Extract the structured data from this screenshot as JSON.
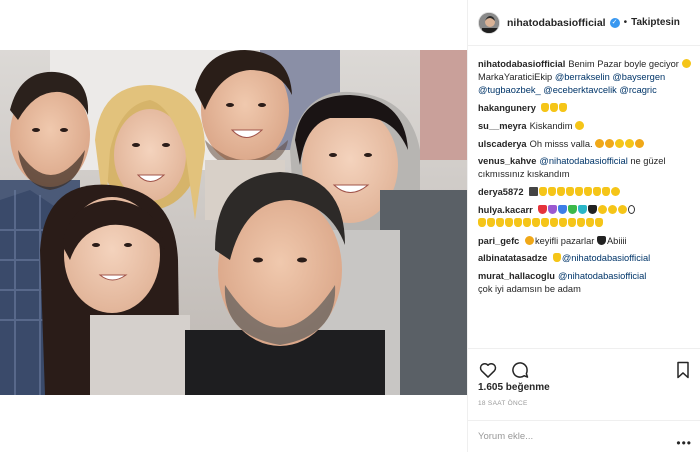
{
  "post": {
    "username": "nihatodabasiofficial",
    "follow_label": "Takiptesin",
    "separator": "•",
    "verified_icon": "verified-badge-icon",
    "photo_icon": "group-selfie-photo"
  },
  "caption": {
    "username": "nihatodabasiofficial",
    "text_1": "Benim Pazar boyle geciyor",
    "text_2": "MarkaYaraticiEkip",
    "mention_1": "@berrakselin",
    "mention_2": "@baysergen",
    "mention_3": "@tugbaozbek_",
    "mention_4": "@eceberktavcelik",
    "mention_5": "@rcagric"
  },
  "comments": [
    {
      "user": "hakangunery",
      "text": ""
    },
    {
      "user": "su__meyra",
      "text": "Kiskandim"
    },
    {
      "user": "ulscaderya",
      "text": "Oh misss valla."
    },
    {
      "user": "venus_kahve",
      "mention": "@nihatodabasiofficial",
      "text": "ne güzel cıkmıssınız kıskandım"
    },
    {
      "user": "derya5872",
      "text": ""
    },
    {
      "user": "hulya.kacarr",
      "text": ""
    },
    {
      "user": "pari_gefc",
      "text_a": "keyifli pazarlar",
      "text_b": "Abiiii"
    },
    {
      "user": "albinatatasadze",
      "mention": "@nihatodabasiofficial"
    },
    {
      "user": "murat_hallacoglu",
      "mention": "@nihatodabasiofficial",
      "text": "çok iyi adamsın be adam"
    }
  ],
  "likes": "1.605 beğenme",
  "time_ago": "18 SAAT ÖNCE",
  "add_comment_placeholder": "Yorum ekle...",
  "more": "•••",
  "colors": {
    "link": "#003569",
    "verified": "#3897f0",
    "muted": "#999999"
  }
}
